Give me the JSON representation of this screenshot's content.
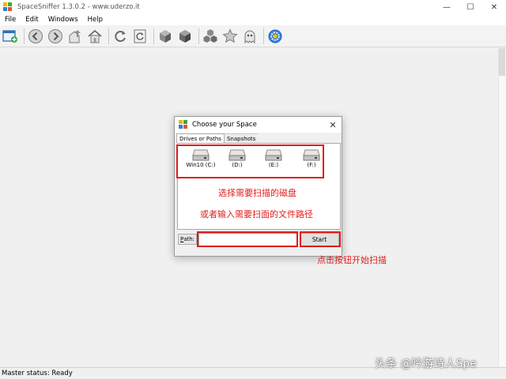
{
  "window": {
    "title": "SpaceSniffer 1.3.0.2 - www.uderzo.it",
    "minimize_glyph": "—",
    "maximize_glyph": "☐",
    "close_glyph": "✕"
  },
  "menu": [
    "File",
    "Edit",
    "Windows",
    "Help"
  ],
  "toolbar": {
    "icons": [
      "new-scan-icon",
      "back-icon",
      "forward-icon",
      "parent-folder-icon",
      "home-icon",
      "refresh-icon",
      "refresh-all-icon",
      "cube-icon",
      "cube-dark-icon",
      "cubes-icon",
      "star-icon",
      "ghost-icon",
      "settings-icon"
    ]
  },
  "status": {
    "text": "Master status: Ready"
  },
  "dialog": {
    "title": "Choose your Space",
    "close_glyph": "✕",
    "tabs": [
      "Drives or Paths",
      "Snapshots"
    ],
    "active_tab": "Drives or Paths",
    "drives": [
      {
        "label": "Win10 (C:)"
      },
      {
        "label": "(D:)"
      },
      {
        "label": "(E:)"
      },
      {
        "label": "(F:)"
      }
    ],
    "path_button_mnemonic": "P",
    "path_button_rest": "ath:",
    "path_value": "",
    "start_label": "Start"
  },
  "annotations": {
    "select_drive": "选择需要扫描的磁盘",
    "or_input_path": "或者输入需要扫面的文件路径",
    "click_start": "点击按钮开始扫描"
  },
  "colors": {
    "annotation_red": "#e01c1c",
    "window_bg": "#f0f0f0",
    "panel_white": "#ffffff"
  },
  "watermark": "头条 @吟游诗人Spe"
}
